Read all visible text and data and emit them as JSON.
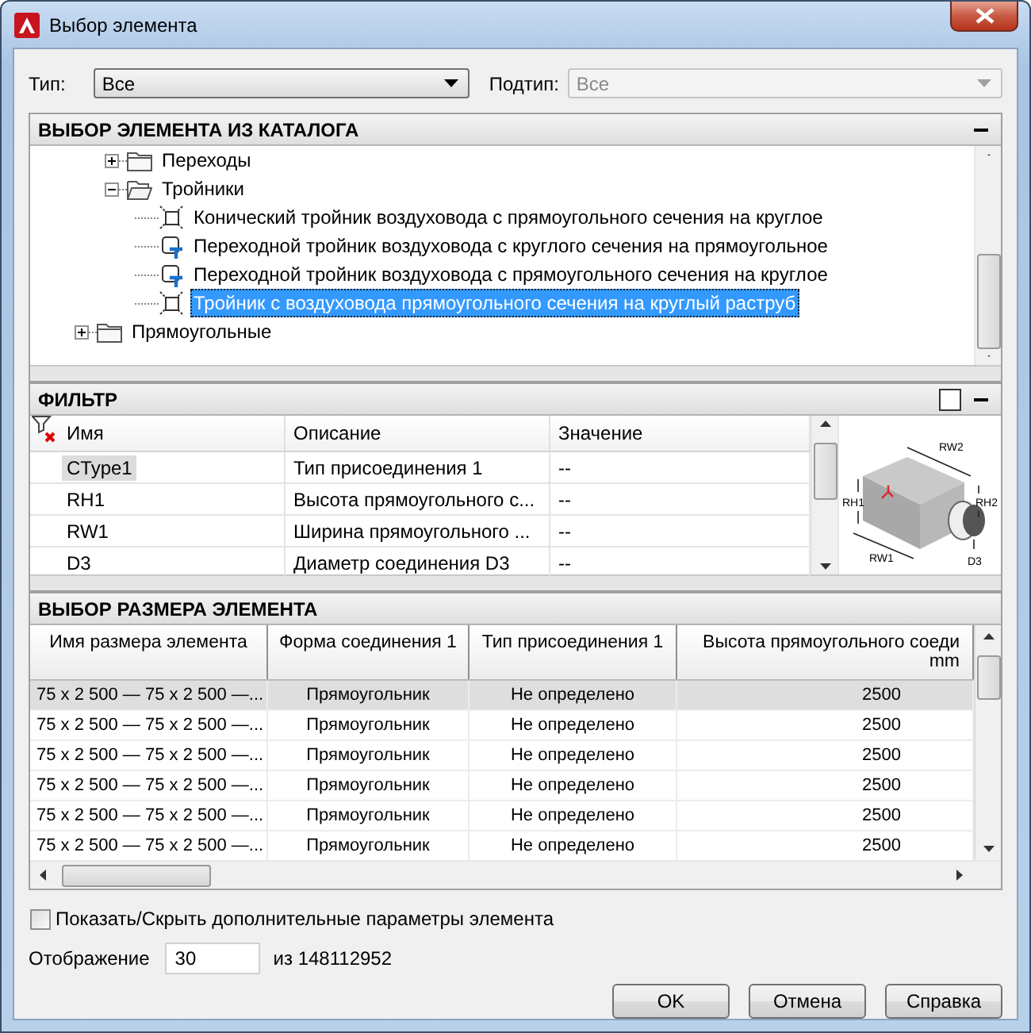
{
  "window": {
    "title": "Выбор элемента"
  },
  "type_row": {
    "type_label": "Тип:",
    "type_value": "Все",
    "subtype_label": "Подтип:",
    "subtype_value": "Все",
    "subtype_disabled": true
  },
  "catalog": {
    "title": "ВЫБОР ЭЛЕМЕНТА ИЗ КАТАЛОГА",
    "tree": [
      {
        "kind": "hidden",
        "children": [
          {
            "kind": "folder",
            "label": "Переходы",
            "expanded": false
          },
          {
            "kind": "folder",
            "label": "Тройники",
            "expanded": true,
            "children": [
              {
                "kind": "part",
                "label": "Конический тройник воздуховода с прямоугольного сечения на круглое",
                "selected": false
              },
              {
                "kind": "part-t",
                "label": "Переходной тройник воздуховода с круглого сечения на прямоугольное",
                "selected": false
              },
              {
                "kind": "part-t",
                "label": "Переходной тройник воздуховода с прямоугольного сечения на круглое",
                "selected": false
              },
              {
                "kind": "part",
                "label": "Тройник с воздуховода прямоугольного сечения на круглый раструб",
                "selected": true
              }
            ]
          }
        ]
      },
      {
        "kind": "folder",
        "label": "Прямоугольные",
        "expanded": false
      }
    ]
  },
  "filter": {
    "title": "ФИЛЬТР",
    "columns": [
      "Имя",
      "Описание",
      "Значение"
    ],
    "rows": [
      {
        "cells": [
          "CType1",
          "Тип присоединения 1",
          "--"
        ],
        "selected": true
      },
      {
        "cells": [
          "RH1",
          "Высота прямоугольного с...",
          "--"
        ],
        "selected": false
      },
      {
        "cells": [
          "RW1",
          "Ширина прямоугольного ...",
          "--"
        ],
        "selected": false
      },
      {
        "cells": [
          "D3",
          "Диаметр соединения D3",
          "--"
        ],
        "selected": false
      }
    ],
    "preview_labels": [
      "RW2",
      "RH1",
      "RH2",
      "RW1",
      "D3"
    ]
  },
  "sizes": {
    "title": "ВЫБОР РАЗМЕРА ЭЛЕМЕНТА",
    "columns": [
      "Имя размера элемента",
      "Форма соединения 1",
      "Тип присоединения 1",
      "Высота прямоугольного соеди"
    ],
    "unit": "mm",
    "rows": [
      {
        "cells": [
          "75 x 2 500 — 75 x 2 500 —...",
          "Прямоугольник",
          "Не определено",
          "2500"
        ],
        "selected": true
      },
      {
        "cells": [
          "75 x 2 500 — 75 x 2 500 —...",
          "Прямоугольник",
          "Не определено",
          "2500"
        ],
        "selected": false
      },
      {
        "cells": [
          "75 x 2 500 — 75 x 2 500 —...",
          "Прямоугольник",
          "Не определено",
          "2500"
        ],
        "selected": false
      },
      {
        "cells": [
          "75 x 2 500 — 75 x 2 500 —...",
          "Прямоугольник",
          "Не определено",
          "2500"
        ],
        "selected": false
      },
      {
        "cells": [
          "75 x 2 500 — 75 x 2 500 —...",
          "Прямоугольник",
          "Не определено",
          "2500"
        ],
        "selected": false
      },
      {
        "cells": [
          "75 x 2 500 — 75 x 2 500 —...",
          "Прямоугольник",
          "Не определено",
          "2500"
        ],
        "selected": false
      }
    ]
  },
  "options": {
    "label": "Показать/Скрыть дополнительные параметры элемента",
    "checked": false
  },
  "display": {
    "label": "Отображение",
    "value": "30",
    "total": "из 148112952"
  },
  "buttons": [
    "OK",
    "Отмена",
    "Справка"
  ]
}
